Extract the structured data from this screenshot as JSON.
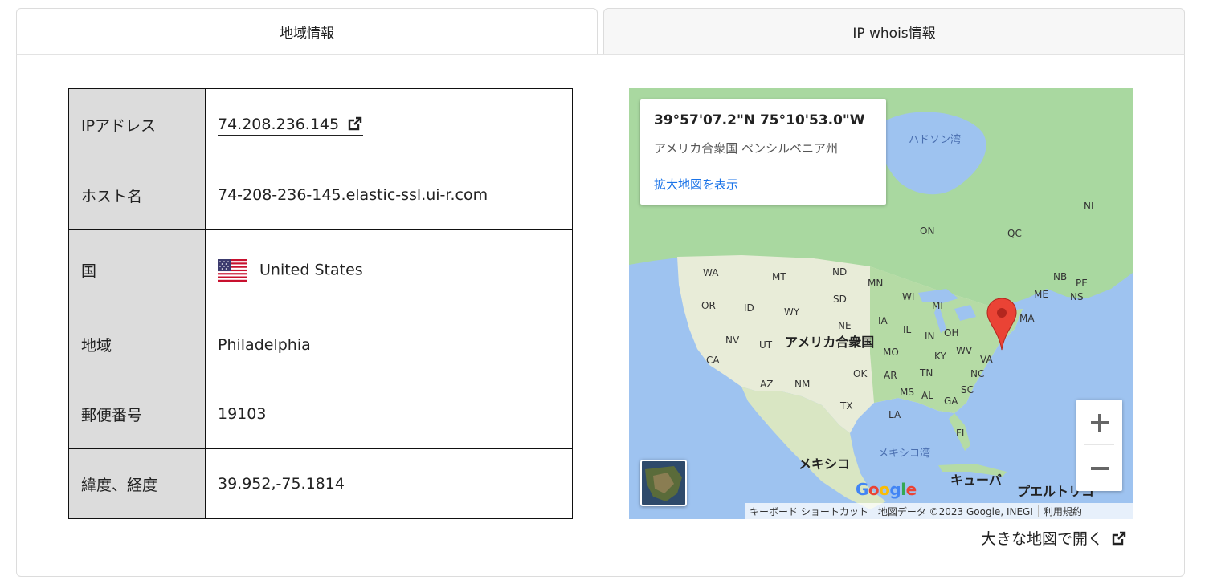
{
  "tabs": [
    {
      "label": "地域情報",
      "active": true
    },
    {
      "label": "IP whois情報",
      "active": false
    }
  ],
  "info_table": {
    "rows": [
      {
        "label": "IPアドレス",
        "value": "74.208.236.145"
      },
      {
        "label": "ホスト名",
        "value": "74-208-236-145.elastic-ssl.ui-r.com"
      },
      {
        "label": "国",
        "value": "United States"
      },
      {
        "label": "地域",
        "value": "Philadelphia"
      },
      {
        "label": "郵便番号",
        "value": "19103"
      },
      {
        "label": "緯度、経度",
        "value": "39.952,-75.1814"
      }
    ]
  },
  "map": {
    "coords": "39°57'07.2\"N 75°10'53.0\"W",
    "region": "アメリカ合衆国 ペンシルベニア州",
    "enlarge_link": "拡大地図を表示",
    "labels": {
      "hudson_bay": "ハドソン湾",
      "usa": "アメリカ合衆国",
      "mexico": "メキシコ",
      "gulf": "メキシコ湾",
      "cuba": "キューバ",
      "puerto_rico": "プエルトリコ",
      "NL": "NL",
      "ON": "ON",
      "QC": "QC",
      "NB": "NB",
      "PE": "PE",
      "NS": "NS",
      "ME": "ME",
      "MA": "MA",
      "WA": "WA",
      "MT": "MT",
      "ND": "ND",
      "MN": "MN",
      "OR": "OR",
      "ID": "ID",
      "SD": "SD",
      "WI": "WI",
      "MI": "MI",
      "WY": "WY",
      "NE": "NE",
      "IA": "IA",
      "IL": "IL",
      "IN": "IN",
      "OH": "OH",
      "NV": "NV",
      "UT": "UT",
      "MO": "MO",
      "KY": "KY",
      "WV": "WV",
      "VA": "VA",
      "CA": "CA",
      "OK": "OK",
      "AR": "AR",
      "TN": "TN",
      "NC": "NC",
      "AZ": "AZ",
      "NM": "NM",
      "MS": "MS",
      "AL": "AL",
      "GA": "GA",
      "SC": "SC",
      "TX": "TX",
      "LA": "LA",
      "FL": "FL"
    },
    "google_logo": "Google",
    "attribution": {
      "shortcuts": "キーボード ショートカット",
      "map_data": "地図データ ©2023 Google, INEGI",
      "terms": "利用規約"
    }
  },
  "open_big_map": "大きな地図で開く"
}
